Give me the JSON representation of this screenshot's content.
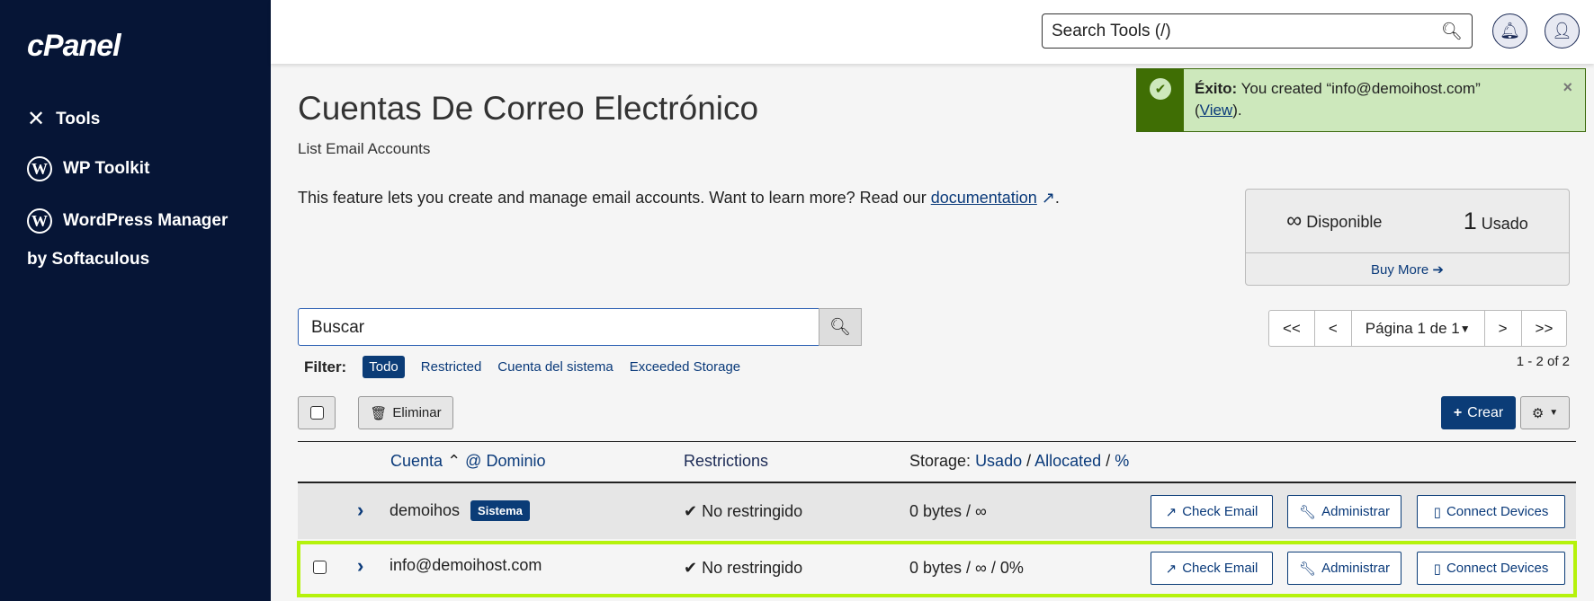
{
  "sidebar": {
    "logo": "cPanel",
    "items": [
      {
        "label": "Tools",
        "icon": "tools-icon"
      },
      {
        "label": "WP Toolkit",
        "icon": "wordpress-icon"
      },
      {
        "label": "WordPress Manager",
        "label2": "by Softaculous",
        "icon": "wordpress-icon"
      }
    ]
  },
  "header": {
    "search_placeholder": "Search Tools (/)"
  },
  "page": {
    "title": "Cuentas De Correo Electrónico",
    "subtitle": "List Email Accounts",
    "description": "This feature lets you create and manage email accounts. Want to learn more? Read our ",
    "doc_link": "documentation",
    "period": "."
  },
  "alert": {
    "strong": "Éxito:",
    "text": " You created “info@demoihost.com”",
    "view_open": "(",
    "view": "View",
    "view_close": ").",
    "close": "×"
  },
  "stats": {
    "available_value": "∞",
    "available_label": "Disponible",
    "used_value": "1",
    "used_label": "Usado",
    "buy_more": "Buy More"
  },
  "search": {
    "value": "Buscar"
  },
  "pagination": {
    "first": "<<",
    "prev": "<",
    "page": "Página 1 de 1",
    "next": ">",
    "last": ">>",
    "count": "1 - 2 of 2"
  },
  "filter": {
    "label": "Filter:",
    "options": [
      "Todo",
      "Restricted",
      "Cuenta del sistema",
      "Exceeded Storage"
    ],
    "active": "Todo"
  },
  "toolbar": {
    "delete": "Eliminar",
    "create": "Crear"
  },
  "table": {
    "headers": {
      "account": "Cuenta",
      "at_domain": "@ Dominio",
      "restrictions": "Restrictions",
      "storage": "Storage:",
      "used": "Usado",
      "allocated": "Allocated",
      "percent": "%",
      "sep": "/"
    },
    "rows": [
      {
        "account": "demoihos",
        "badge": "Sistema",
        "restriction": "No restringido",
        "storage": "0 bytes / ∞"
      },
      {
        "account": "info@demoihost.com",
        "restriction": "No restringido",
        "storage": "0 bytes / ∞ / 0%"
      }
    ],
    "actions": {
      "check": "Check Email",
      "admin": "Administrar",
      "connect": "Connect Devices"
    }
  },
  "colors": {
    "sidebar": "#061536",
    "primary": "#0b3c77",
    "success": "#3f6e04",
    "highlight": "#b5f20c"
  }
}
